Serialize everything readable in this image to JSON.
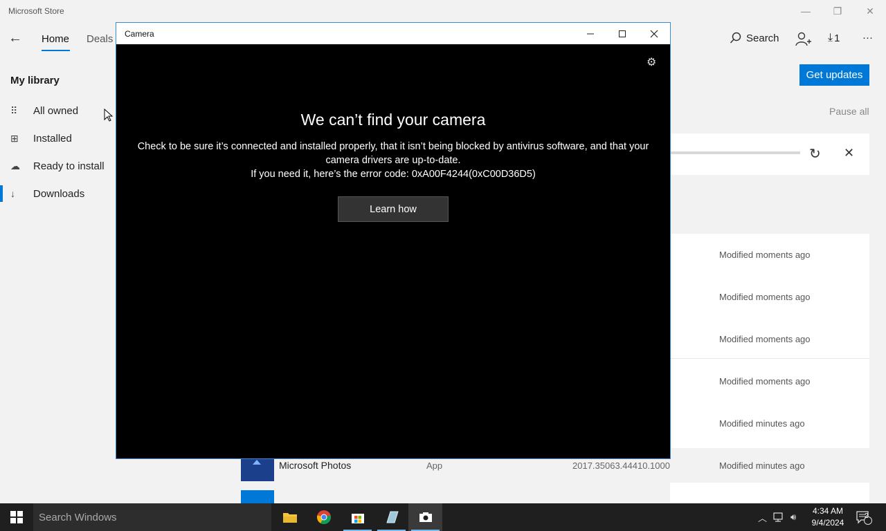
{
  "store": {
    "title": "Microsoft Store",
    "window_controls": {
      "minimize": "—",
      "restore": "❐",
      "close": "✕"
    },
    "nav": {
      "back": "←",
      "tabs": [
        "Home",
        "Deals"
      ]
    },
    "top_right": {
      "search": "Search",
      "downloads_count": "1",
      "more": "···"
    },
    "sidebar": {
      "title": "My library",
      "items": [
        {
          "label": "All owned",
          "icon": "grid-icon"
        },
        {
          "label": "Installed",
          "icon": "installed-icon"
        },
        {
          "label": "Ready to install",
          "icon": "cloud-icon"
        },
        {
          "label": "Downloads",
          "icon": "download-icon"
        }
      ]
    },
    "get_updates": "Get updates",
    "pause_all": "Pause all",
    "modified": [
      "Modified moments ago",
      "Modified moments ago",
      "Modified moments ago",
      "Modified moments ago",
      "Modified minutes ago",
      "Modified minutes ago"
    ],
    "visible_row": {
      "name": "Microsoft Photos",
      "type": "App",
      "version": "2017.35063.44410.1000"
    }
  },
  "camera": {
    "title": "Camera",
    "heading": "We can’t find your camera",
    "message_line1": "Check to be sure it’s connected and installed properly, that it isn’t being blocked by antivirus software, and that your camera drivers are up-to-date.",
    "message_line2": "If you need it, here’s the error code: 0xA00F4244(0xC00D36D5)",
    "button": "Learn how"
  },
  "taskbar": {
    "search_placeholder": "Search Windows",
    "time": "4:34 AM",
    "date": "9/4/2024",
    "notifications": "2"
  },
  "colors": {
    "accent": "#0078d7",
    "camera_bg": "#000000",
    "taskbar": "#1f1f1f"
  }
}
